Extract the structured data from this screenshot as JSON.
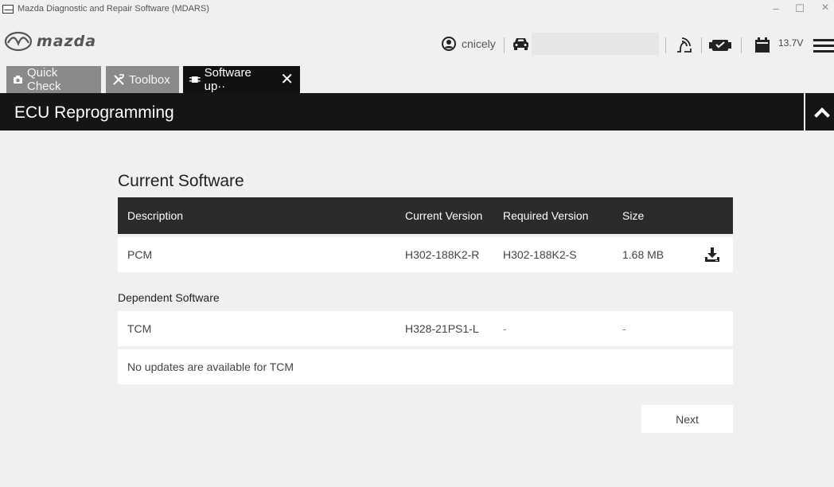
{
  "window": {
    "title": "Mazda Diagnostic and Repair Software (MDARS)",
    "minimize": "–",
    "maximize": "☐",
    "close": "×"
  },
  "header": {
    "logo_text": "mazda",
    "username": "cnicely",
    "vin_value": "",
    "voltage": "13.7V"
  },
  "tabs": [
    {
      "label": "Quick Check",
      "icon": "camera-icon",
      "active": false
    },
    {
      "label": "Toolbox",
      "icon": "tools-icon",
      "active": false
    },
    {
      "label": "Software up··",
      "icon": "chip-icon",
      "active": true,
      "close": "✕"
    }
  ],
  "page": {
    "title": "ECU Reprogramming"
  },
  "current_software": {
    "title": "Current Software",
    "columns": [
      "Description",
      "Current Version",
      "Required Version",
      "Size"
    ],
    "rows": [
      {
        "description": "PCM",
        "current_version": "H302-188K2-R",
        "required_version": "H302-188K2-S",
        "size": "1.68 MB"
      }
    ]
  },
  "dependent_software": {
    "title": "Dependent Software",
    "rows": [
      {
        "description": "TCM",
        "current_version": "H328-21PS1-L",
        "required_version": "-",
        "size": "-"
      }
    ],
    "message": "No updates are available for TCM"
  },
  "actions": {
    "next_label": "Next"
  }
}
